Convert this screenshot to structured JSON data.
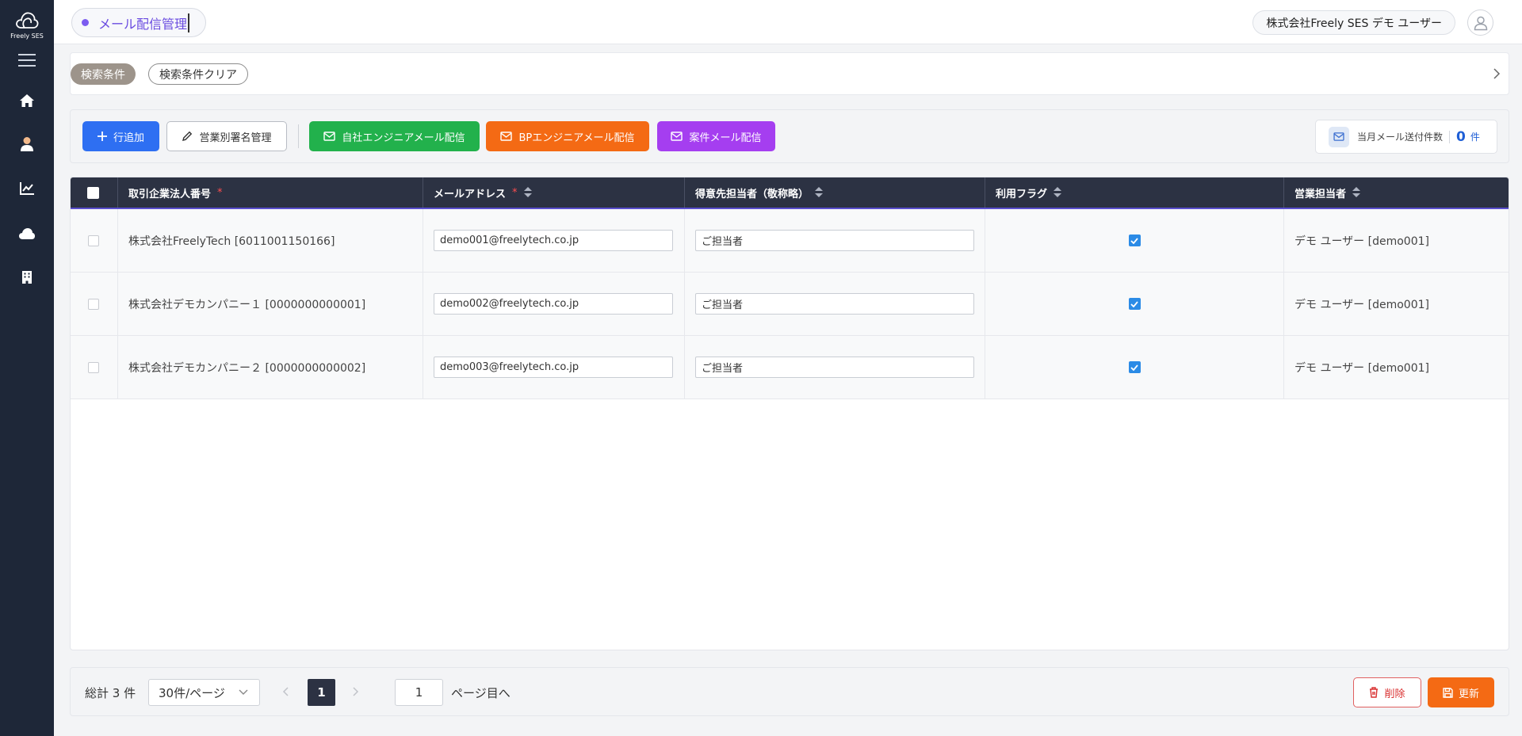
{
  "app": {
    "logo_text": "Freely SES"
  },
  "sidebar": {
    "items": [
      {
        "icon": "menu-icon"
      },
      {
        "icon": "home-icon"
      },
      {
        "icon": "user-icon"
      },
      {
        "icon": "chart-icon"
      },
      {
        "icon": "cloud-icon"
      },
      {
        "icon": "building-icon"
      }
    ]
  },
  "header": {
    "page_title": "メール配信管理",
    "user_name": "株式会社Freely SES デモ ユーザー"
  },
  "search": {
    "condition_label": "検索条件",
    "clear_label": "検索条件クリア"
  },
  "toolbar": {
    "add_row": "行追加",
    "signature": "営業別署名管理",
    "own_engineer_mail": "自社エンジニアメール配信",
    "bp_engineer_mail": "BPエンジニアメール配信",
    "project_mail": "案件メール配信",
    "monthly_count_label": "当月メール送付件数",
    "monthly_count": "0",
    "monthly_count_unit": "件"
  },
  "table": {
    "headers": {
      "company": "取引企業法人番号",
      "email": "メールアドレス",
      "contact": "得意先担当者（敬称略）",
      "flag": "利用フラグ",
      "sales": "営業担当者"
    },
    "required_mark": "*",
    "rows": [
      {
        "company": "株式会社FreelyTech [6011001150166]",
        "email": "demo001@freelytech.co.jp",
        "contact": "ご担当者",
        "flag": true,
        "sales": "デモ ユーザー [demo001]"
      },
      {
        "company": "株式会社デモカンパニー１ [0000000000001]",
        "email": "demo002@freelytech.co.jp",
        "contact": "ご担当者",
        "flag": true,
        "sales": "デモ ユーザー [demo001]"
      },
      {
        "company": "株式会社デモカンパニー２ [0000000000002]",
        "email": "demo003@freelytech.co.jp",
        "contact": "ご担当者",
        "flag": true,
        "sales": "デモ ユーザー [demo001]"
      }
    ]
  },
  "footer": {
    "total": "総計 3 件",
    "per_page": "30件/ページ",
    "current_page": "1",
    "goto_value": "1",
    "goto_label": "ページ目へ",
    "delete_label": "削除",
    "update_label": "更新"
  },
  "colors": {
    "sidebar": "#1e2738",
    "accent_purple": "#6a4be0",
    "primary": "#2e6ff2",
    "green": "#22b14c",
    "orange": "#f46a14",
    "purple": "#a53ef0"
  }
}
